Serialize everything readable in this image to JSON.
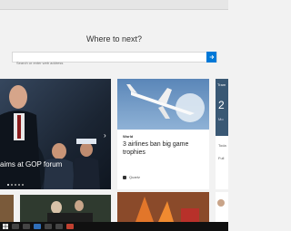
{
  "start": {
    "heading": "Where to next?",
    "search_placeholder": "Search or enter web address"
  },
  "hero": {
    "caption": "aims at GOP forum",
    "banner": "SPAN"
  },
  "news": {
    "tag": "World",
    "headline": "3 airlines ban big game trophies",
    "source": "Quartz"
  },
  "weather": {
    "label": "Tram",
    "temp": "2",
    "day": "Mo",
    "today": "Toda",
    "full": "Full"
  },
  "colors": {
    "accent": "#0078d7"
  }
}
